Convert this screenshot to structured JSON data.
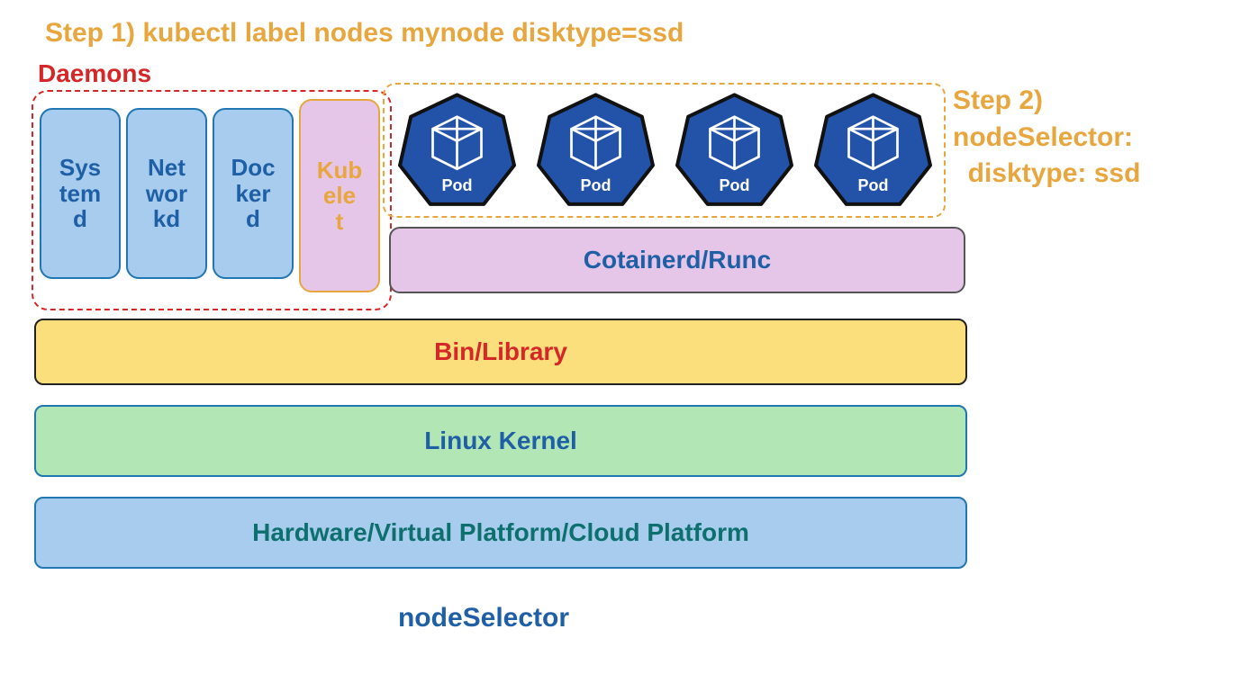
{
  "step1": "Step 1) kubectl label nodes mynode disktype=ssd",
  "step2": "Step 2)\nnodeSelector:\n  disktype: ssd",
  "daemons_label": "Daemons",
  "daemons": {
    "systemd": "Sys\ntem\nd",
    "networkd": "Net\nwor\nkd",
    "dockerd": "Doc\nker\nd",
    "kubelet": "Kub\nele\nt"
  },
  "pods": {
    "label": "Pod",
    "count": 4
  },
  "layers": {
    "containerd": "Cotainerd/Runc",
    "binlib": "Bin/Library",
    "kernel": "Linux Kernel",
    "hardware": "Hardware/Virtual Platform/Cloud Platform"
  },
  "caption": "nodeSelector",
  "colors": {
    "orange": "#e8a63f",
    "red": "#d62728",
    "blue_border": "#1f77b4",
    "blue_text": "#1f5fa5",
    "blue_fill": "#a7cced",
    "purple_fill": "#e6c6e8",
    "yellow_fill": "#fcdf7d",
    "green_fill": "#b3e6b5",
    "teal_text": "#0e6f6f",
    "pod_fill": "#2353a8"
  }
}
